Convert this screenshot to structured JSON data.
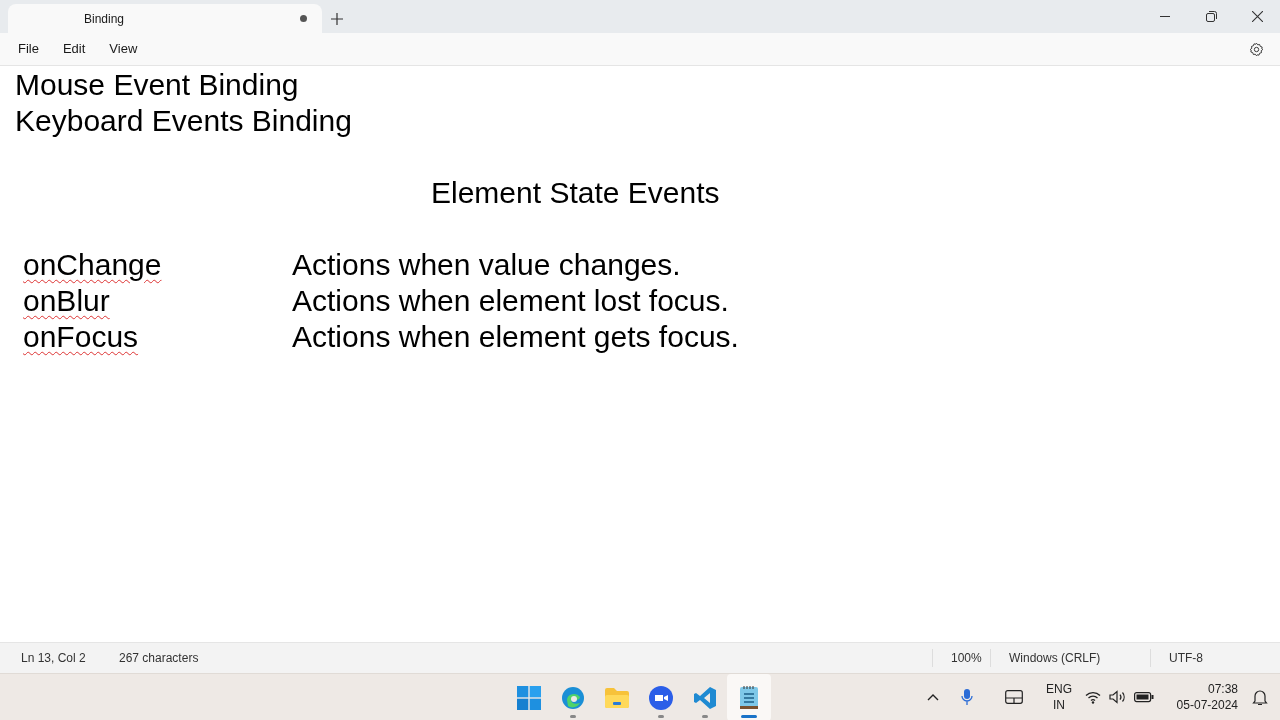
{
  "window": {
    "tab_title": "Binding",
    "tab_modified": true
  },
  "menu": [
    "File",
    "Edit",
    "View"
  ],
  "editor": {
    "lines": [
      {
        "kind": "plain",
        "text": "Mouse Event Binding"
      },
      {
        "kind": "plain",
        "text": "Keyboard Events Binding"
      },
      {
        "kind": "blank"
      },
      {
        "kind": "heading",
        "text": "Element State Events"
      },
      {
        "kind": "blank"
      },
      {
        "kind": "pair",
        "term": "onChange",
        "description": "Actions when value changes.",
        "misspelled": true
      },
      {
        "kind": "pair",
        "term": "onBlur",
        "description": "Actions when element lost focus.",
        "misspelled": true
      },
      {
        "kind": "pair",
        "term": "onFocus",
        "description": "Actions when element gets focus.",
        "misspelled": true
      }
    ]
  },
  "status_bar": {
    "position": "Ln 13, Col 2",
    "characters": "267 characters",
    "zoom": "100%",
    "line_ending": "Windows (CRLF)",
    "encoding": "UTF-8"
  },
  "taskbar": {
    "apps": [
      {
        "kind": "start",
        "running": false,
        "selected": false
      },
      {
        "kind": "browser",
        "running": true,
        "selected": false
      },
      {
        "kind": "folder",
        "running": false,
        "selected": false
      },
      {
        "kind": "zoom",
        "running": true,
        "selected": false
      },
      {
        "kind": "code",
        "running": true,
        "selected": false
      },
      {
        "kind": "notepad",
        "running": true,
        "selected": true
      }
    ],
    "language": "ENG",
    "region": "IN",
    "time": "07:38",
    "date": "05-07-2024"
  }
}
